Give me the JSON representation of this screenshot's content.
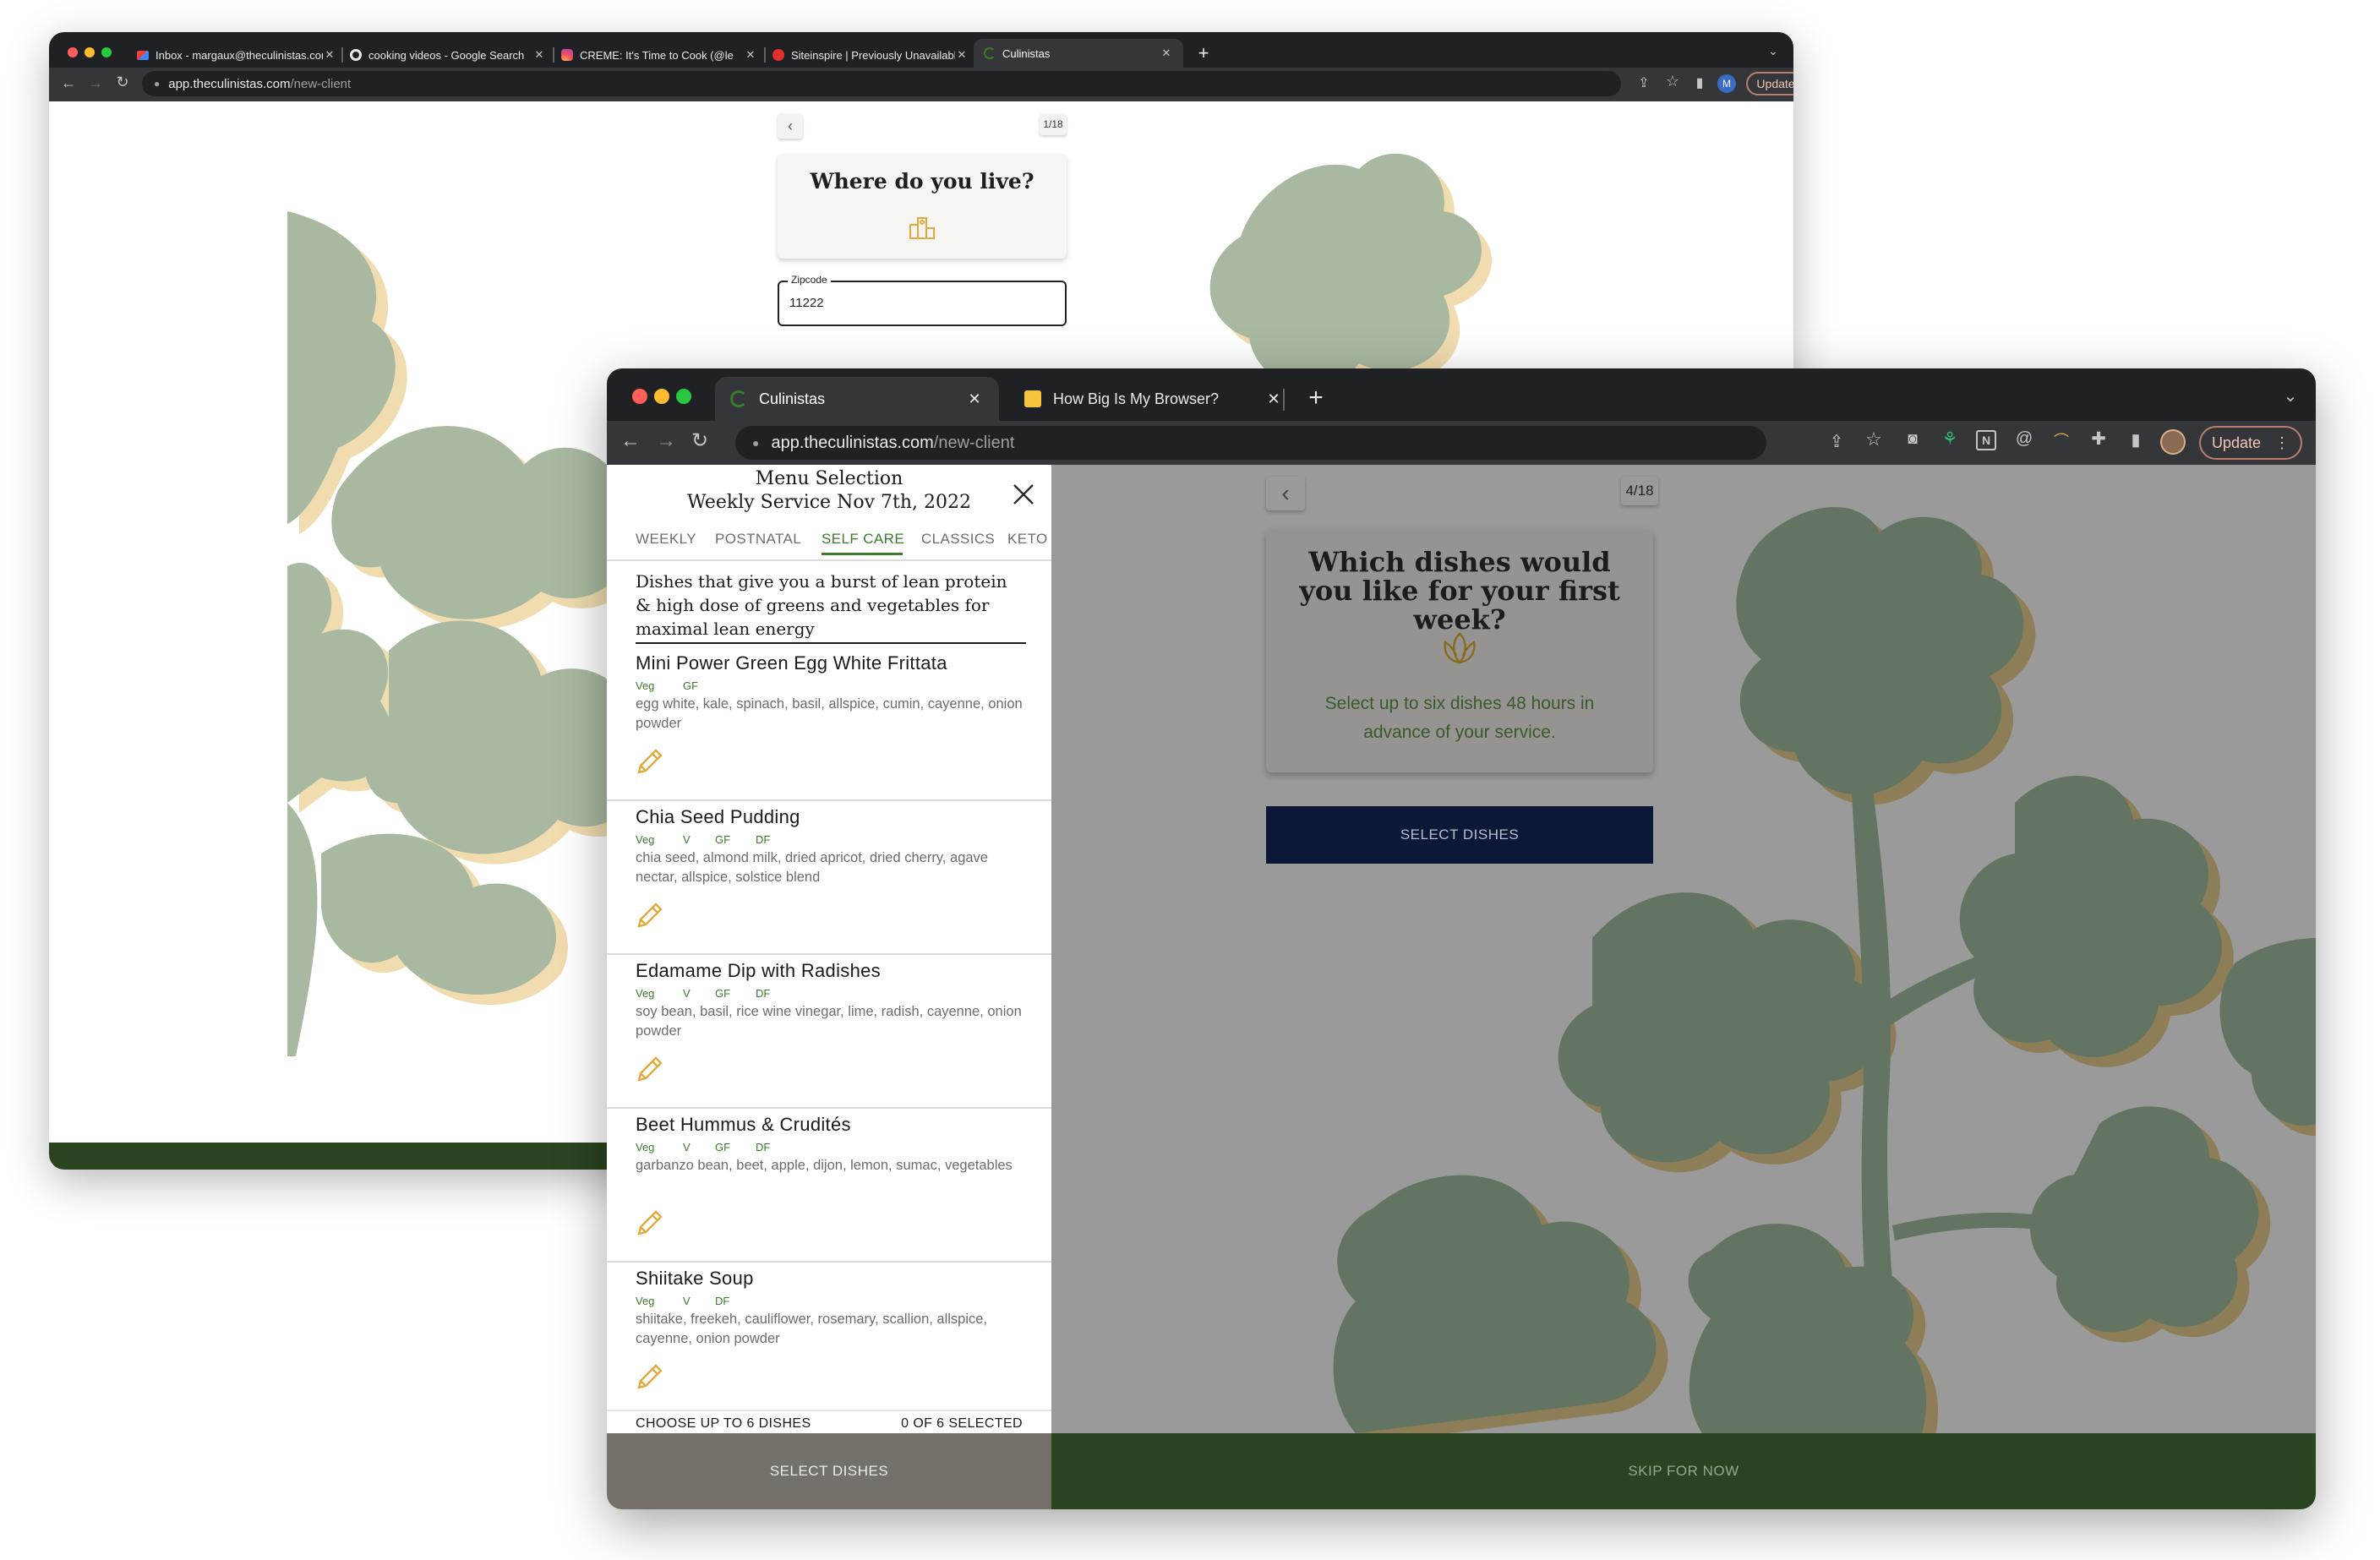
{
  "back_window": {
    "tabs": [
      {
        "label": "Inbox - margaux@theculinistas.com",
        "icon": "gmail-icon"
      },
      {
        "label": "cooking videos - Google Search",
        "icon": "google-icon"
      },
      {
        "label": "CREME: It's Time to Cook (@le",
        "icon": "instagram-icon"
      },
      {
        "label": "Siteinspire | Previously Unavailable",
        "icon": "siteinspire-icon"
      },
      {
        "label": "Culinistas",
        "icon": "culinistas-icon",
        "active": true
      }
    ],
    "url_host": "app.theculinistas.com",
    "url_path": "/new-client",
    "update_label": "Update",
    "step_counter": "1/18",
    "question_title": "Where do you live?",
    "zipcode": {
      "label": "Zipcode",
      "value": "11222"
    }
  },
  "front_window": {
    "tabs": [
      {
        "label": "Culinistas",
        "icon": "culinistas-icon",
        "active": true
      },
      {
        "label": "How Big Is My Browser?",
        "icon": "browser-size-icon"
      }
    ],
    "url_host": "app.theculinistas.com",
    "url_path": "/new-client",
    "update_label": "Update",
    "menu_panel": {
      "title": "Menu Selection",
      "subtitle": "Weekly Service Nov 7th, 2022",
      "tabs": [
        "WEEKLY",
        "POSTNATAL",
        "SELF CARE",
        "CLASSICS",
        "KETO"
      ],
      "active_tab": "SELF CARE",
      "description": "Dishes that give you a burst of lean protein & high dose of greens and vegetables for maximal lean energy",
      "dishes": [
        {
          "name": "Mini Power Green Egg White Frittata",
          "tags": [
            "Veg",
            "GF"
          ],
          "ingredients": "egg white, kale, spinach, basil, allspice, cumin, cayenne, onion powder"
        },
        {
          "name": "Chia Seed Pudding",
          "tags": [
            "Veg",
            "V",
            "GF",
            "DF"
          ],
          "ingredients": "chia seed, almond milk, dried apricot, dried cherry, agave nectar, allspice, solstice blend"
        },
        {
          "name": "Edamame Dip with Radishes",
          "tags": [
            "Veg",
            "V",
            "GF",
            "DF"
          ],
          "ingredients": "soy bean, basil, rice wine vinegar, lime, radish, cayenne, onion powder"
        },
        {
          "name": "Beet Hummus & Crudités",
          "tags": [
            "Veg",
            "V",
            "GF",
            "DF"
          ],
          "ingredients": "garbanzo bean, beet, apple, dijon, lemon, sumac, vegetables"
        },
        {
          "name": "Shiitake Soup",
          "tags": [
            "Veg",
            "V",
            "DF"
          ],
          "ingredients": "shiitake, freekeh, cauliflower, rosemary, scallion, allspice, cayenne, onion powder"
        }
      ],
      "footer_left": "CHOOSE UP TO 6 DISHES",
      "footer_right": "0 OF 6 SELECTED",
      "select_button": "SELECT DISHES"
    },
    "step_counter": "4/18",
    "question_title": "Which dishes would you like for your first week?",
    "question_subtitle": "Select up to six dishes 48 hours in advance of your service.",
    "select_dishes_button": "SELECT DISHES",
    "skip_button": "SKIP FOR NOW"
  },
  "colors": {
    "leaf_light": "#a9b9a1",
    "leaf_dark": "#647462",
    "leaf_shadow": "#f0dcae",
    "leaf_shadow_dark": "#8e7e58",
    "navy": "#0c1838",
    "forest": "#2a4420",
    "accent_gold": "#e0aa3e",
    "tag_green": "#3c7a2c"
  }
}
